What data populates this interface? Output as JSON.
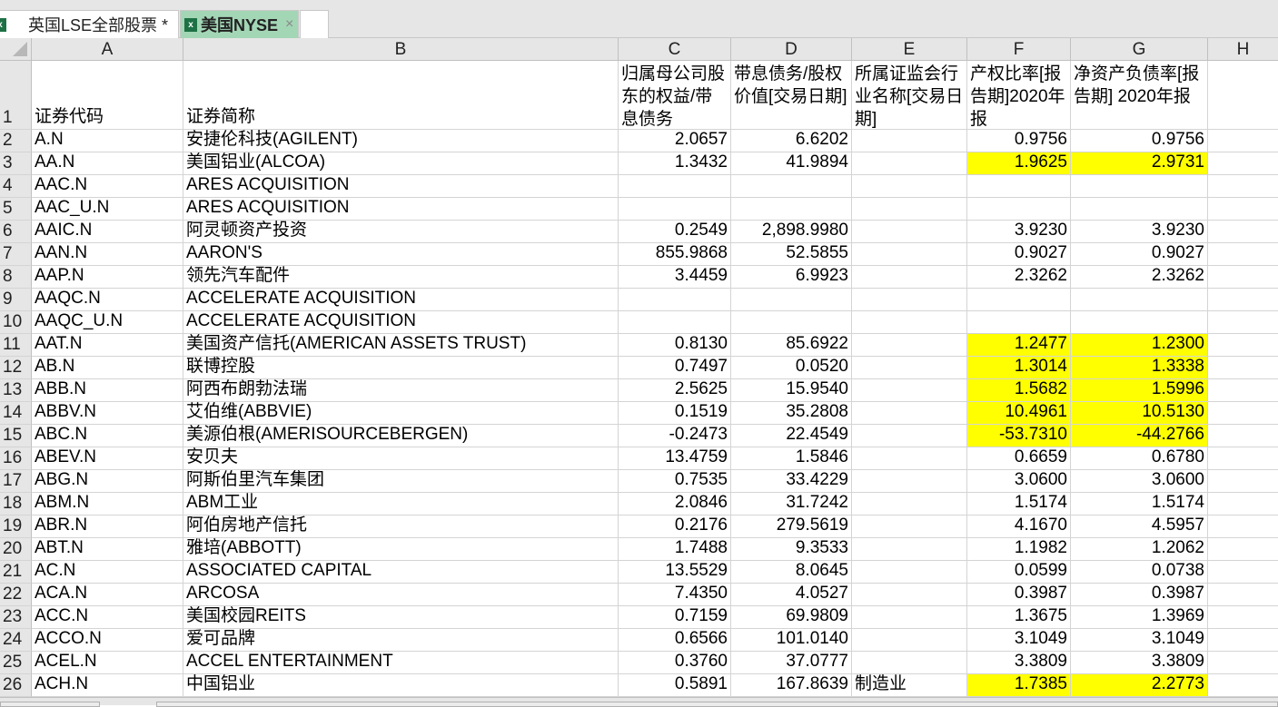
{
  "tabs": [
    {
      "label": "英国LSE全部股票 *",
      "icon": "excel-icon",
      "active": false
    },
    {
      "label": "美国NYSE",
      "icon": "excel-icon",
      "active": true,
      "close": "×"
    }
  ],
  "columns": [
    "A",
    "B",
    "C",
    "D",
    "E",
    "F",
    "G",
    "H"
  ],
  "header_row": {
    "num": "1",
    "cells": [
      "证券代码",
      "证券简称",
      "归属母公司股东的权益/带息债务",
      "带息债务/股权价值[交易日期]",
      "所属证监会行业名称[交易日期]",
      "产权比率[报告期]2020年报",
      "净资产负债率[报告期] 2020年报",
      ""
    ]
  },
  "highlight_color": "#ffff00",
  "rows": [
    {
      "n": "2",
      "a": "A.N",
      "b": "安捷伦科技(AGILENT)",
      "c": "2.0657",
      "d": "6.6202",
      "e": "",
      "f": "0.9756",
      "g": "0.9756",
      "hl": false
    },
    {
      "n": "3",
      "a": "AA.N",
      "b": "美国铝业(ALCOA)",
      "c": "1.3432",
      "d": "41.9894",
      "e": "",
      "f": "1.9625",
      "g": "2.9731",
      "hl": true
    },
    {
      "n": "4",
      "a": "AAC.N",
      "b": "ARES ACQUISITION",
      "c": "",
      "d": "",
      "e": "",
      "f": "",
      "g": "",
      "hl": false
    },
    {
      "n": "5",
      "a": "AAC_U.N",
      "b": "ARES ACQUISITION",
      "c": "",
      "d": "",
      "e": "",
      "f": "",
      "g": "",
      "hl": false
    },
    {
      "n": "6",
      "a": "AAIC.N",
      "b": "阿灵顿资产投资",
      "c": "0.2549",
      "d": "2,898.9980",
      "e": "",
      "f": "3.9230",
      "g": "3.9230",
      "hl": false
    },
    {
      "n": "7",
      "a": "AAN.N",
      "b": "AARON'S",
      "c": "855.9868",
      "d": "52.5855",
      "e": "",
      "f": "0.9027",
      "g": "0.9027",
      "hl": false
    },
    {
      "n": "8",
      "a": "AAP.N",
      "b": "领先汽车配件",
      "c": "3.4459",
      "d": "6.9923",
      "e": "",
      "f": "2.3262",
      "g": "2.3262",
      "hl": false
    },
    {
      "n": "9",
      "a": "AAQC.N",
      "b": "ACCELERATE ACQUISITION",
      "c": "",
      "d": "",
      "e": "",
      "f": "",
      "g": "",
      "hl": false
    },
    {
      "n": "10",
      "a": "AAQC_U.N",
      "b": "ACCELERATE ACQUISITION",
      "c": "",
      "d": "",
      "e": "",
      "f": "",
      "g": "",
      "hl": false
    },
    {
      "n": "11",
      "a": "AAT.N",
      "b": "美国资产信托(AMERICAN ASSETS TRUST)",
      "c": "0.8130",
      "d": "85.6922",
      "e": "",
      "f": "1.2477",
      "g": "1.2300",
      "hl": true
    },
    {
      "n": "12",
      "a": "AB.N",
      "b": "联博控股",
      "c": "0.7497",
      "d": "0.0520",
      "e": "",
      "f": "1.3014",
      "g": "1.3338",
      "hl": true
    },
    {
      "n": "13",
      "a": "ABB.N",
      "b": "阿西布朗勃法瑞",
      "c": "2.5625",
      "d": "15.9540",
      "e": "",
      "f": "1.5682",
      "g": "1.5996",
      "hl": true
    },
    {
      "n": "14",
      "a": "ABBV.N",
      "b": "艾伯维(ABBVIE)",
      "c": "0.1519",
      "d": "35.2808",
      "e": "",
      "f": "10.4961",
      "g": "10.5130",
      "hl": true
    },
    {
      "n": "15",
      "a": "ABC.N",
      "b": "美源伯根(AMERISOURCEBERGEN)",
      "c": "-0.2473",
      "d": "22.4549",
      "e": "",
      "f": "-53.7310",
      "g": "-44.2766",
      "hl": true
    },
    {
      "n": "16",
      "a": "ABEV.N",
      "b": "安贝夫",
      "c": "13.4759",
      "d": "1.5846",
      "e": "",
      "f": "0.6659",
      "g": "0.6780",
      "hl": false
    },
    {
      "n": "17",
      "a": "ABG.N",
      "b": "阿斯伯里汽车集团",
      "c": "0.7535",
      "d": "33.4229",
      "e": "",
      "f": "3.0600",
      "g": "3.0600",
      "hl": false
    },
    {
      "n": "18",
      "a": "ABM.N",
      "b": "ABM工业",
      "c": "2.0846",
      "d": "31.7242",
      "e": "",
      "f": "1.5174",
      "g": "1.5174",
      "hl": false
    },
    {
      "n": "19",
      "a": "ABR.N",
      "b": "阿伯房地产信托",
      "c": "0.2176",
      "d": "279.5619",
      "e": "",
      "f": "4.1670",
      "g": "4.5957",
      "hl": false
    },
    {
      "n": "20",
      "a": "ABT.N",
      "b": "雅培(ABBOTT)",
      "c": "1.7488",
      "d": "9.3533",
      "e": "",
      "f": "1.1982",
      "g": "1.2062",
      "hl": false
    },
    {
      "n": "21",
      "a": "AC.N",
      "b": "ASSOCIATED CAPITAL",
      "c": "13.5529",
      "d": "8.0645",
      "e": "",
      "f": "0.0599",
      "g": "0.0738",
      "hl": false
    },
    {
      "n": "22",
      "a": "ACA.N",
      "b": "ARCOSA",
      "c": "7.4350",
      "d": "4.0527",
      "e": "",
      "f": "0.3987",
      "g": "0.3987",
      "hl": false
    },
    {
      "n": "23",
      "a": "ACC.N",
      "b": "美国校园REITS",
      "c": "0.7159",
      "d": "69.9809",
      "e": "",
      "f": "1.3675",
      "g": "1.3969",
      "hl": false
    },
    {
      "n": "24",
      "a": "ACCO.N",
      "b": "爱可品牌",
      "c": "0.6566",
      "d": "101.0140",
      "e": "",
      "f": "3.1049",
      "g": "3.1049",
      "hl": false
    },
    {
      "n": "25",
      "a": "ACEL.N",
      "b": "ACCEL ENTERTAINMENT",
      "c": "0.3760",
      "d": "37.0777",
      "e": "",
      "f": "3.3809",
      "g": "3.3809",
      "hl": false
    },
    {
      "n": "26",
      "a": "ACH.N",
      "b": "中国铝业",
      "c": "0.5891",
      "d": "167.8639",
      "e": "制造业",
      "f": "1.7385",
      "g": "2.2773",
      "hl": true
    }
  ]
}
